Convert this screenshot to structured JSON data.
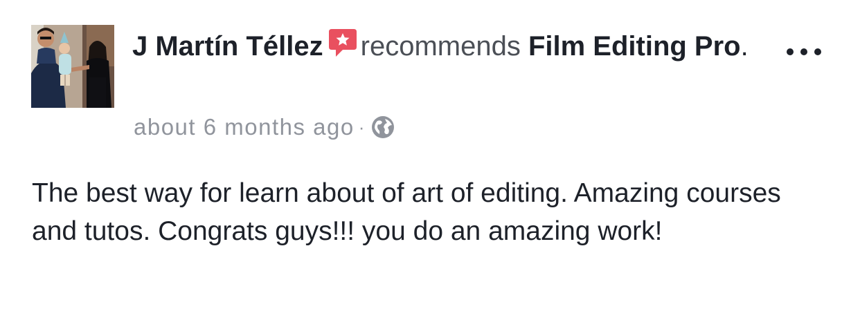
{
  "post": {
    "author": "J Martín Téllez",
    "action": "recommends",
    "page_name": "Film Editing Pro",
    "punctuation": ".",
    "timestamp": "about 6 months ago",
    "separator": "·",
    "privacy_icon": "globe-icon",
    "recommend_icon": "recommend-star-icon",
    "more_icon": "more-options-icon",
    "body": "The best way for learn about of art of editing. Amazing courses and tutos. Congrats guys!!! you do an amazing work!"
  },
  "colors": {
    "recommend_red": "#e9505f",
    "text_primary": "#1d2129",
    "text_meta": "#90949c"
  }
}
